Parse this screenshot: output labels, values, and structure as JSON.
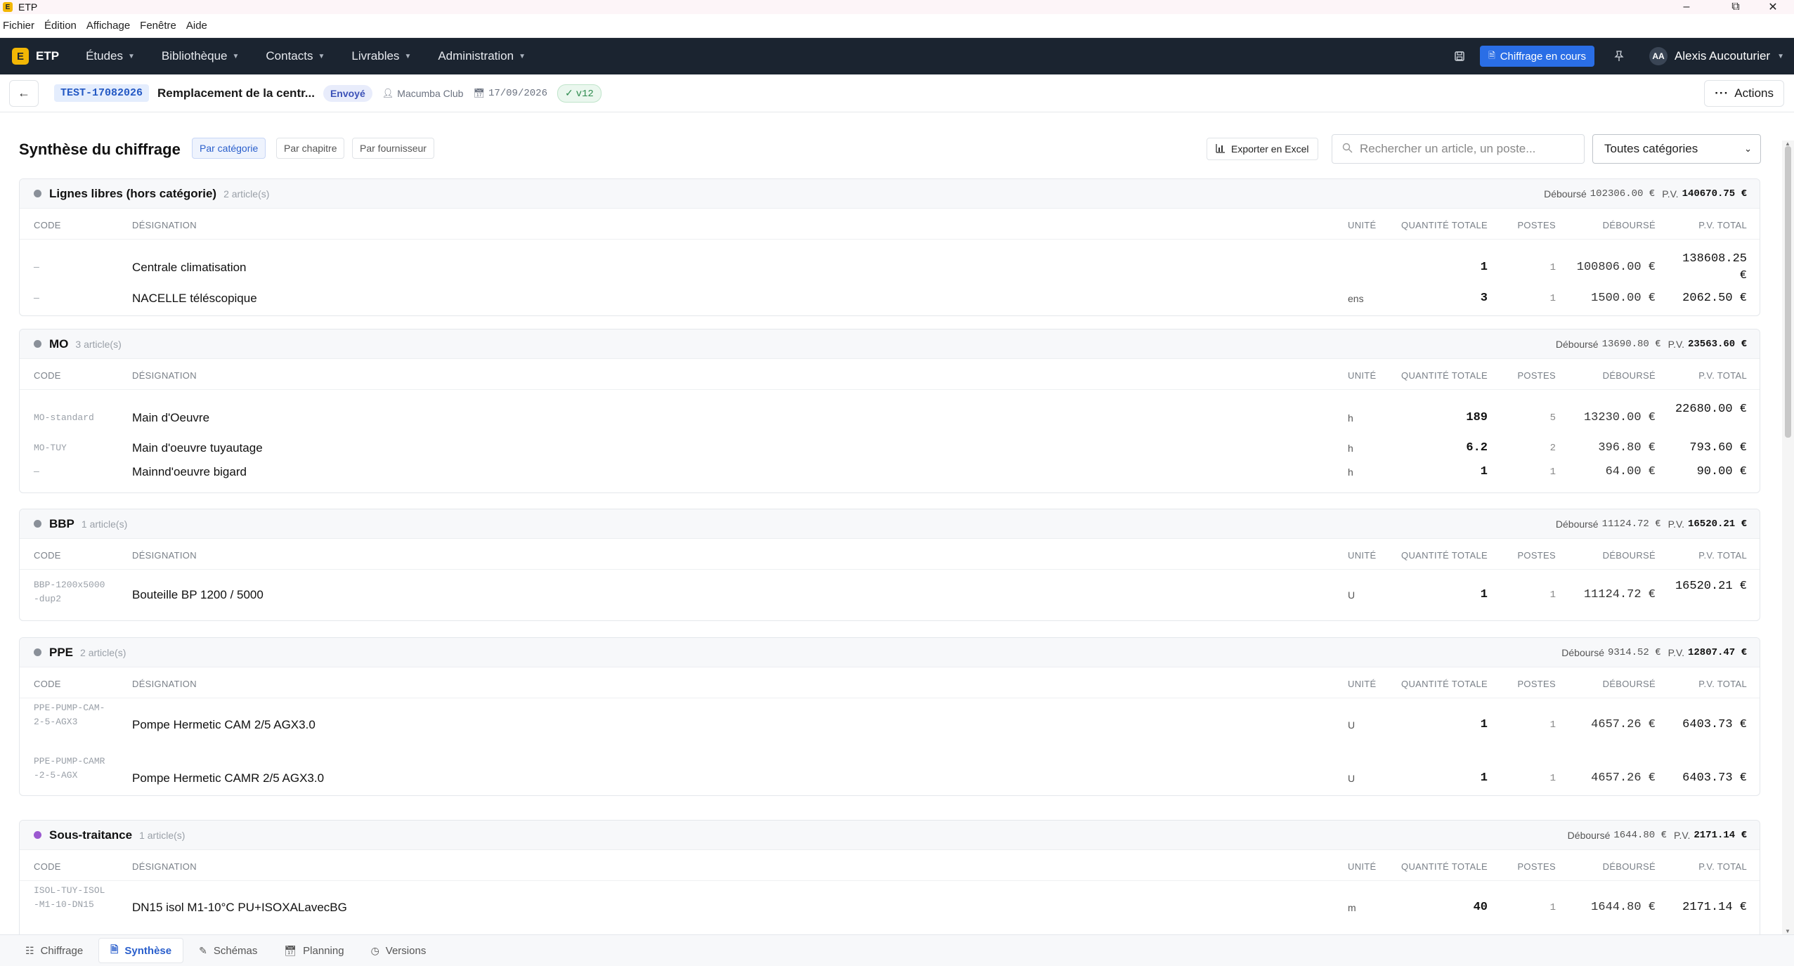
{
  "window": {
    "title": "ETP",
    "app_icon_letter": "E"
  },
  "menu": [
    "Fichier",
    "Édition",
    "Affichage",
    "Fenêtre",
    "Aide"
  ],
  "nav": {
    "brand": "ETP",
    "brand_logo_letter": "E",
    "items": [
      "Études",
      "Bibliothèque",
      "Contacts",
      "Livrables",
      "Administration"
    ],
    "chiffrage_button": "Chiffrage en cours",
    "user_initials": "AA",
    "user_name": "Alexis Aucouturier"
  },
  "header": {
    "reference": "TEST-17082026",
    "project_title": "Remplacement de la centr...",
    "status": "Envoyé",
    "client": "Macumba Club",
    "date": "17/09/2026",
    "version": "v12",
    "actions_label": "Actions"
  },
  "toolbar": {
    "title": "Synthèse du chiffrage",
    "segments": [
      "Par catégorie",
      "Par chapitre",
      "Par fournisseur"
    ],
    "export_label": "Exporter en Excel",
    "search_placeholder": "Rechercher un article, un poste...",
    "category_select": "Toutes catégories"
  },
  "columns": {
    "code": "CODE",
    "designation": "DÉSIGNATION",
    "unit": "UNITÉ",
    "qty": "QUANTITÉ TOTALE",
    "postes": "POSTES",
    "debourse": "DÉBOURSÉ",
    "pv": "P.V. TOTAL"
  },
  "labels": {
    "debourse": "Déboursé",
    "pv": "P.V."
  },
  "categories": [
    {
      "name": "Lignes libres (hors catégorie)",
      "count": "2 article(s)",
      "debourse": "102306.00 €",
      "pv": "140670.75 €",
      "dot_color": "#8a9099",
      "rows": [
        {
          "code": "—",
          "designation": "Centrale climatisation",
          "unit": "",
          "qty": "1",
          "postes": "1",
          "debourse": "100806.00 €",
          "pv": "138608.25 €"
        },
        {
          "code": "—",
          "designation": "NACELLE téléscopique",
          "unit": "ens",
          "qty": "3",
          "postes": "1",
          "debourse": "1500.00 €",
          "pv": "2062.50 €"
        }
      ]
    },
    {
      "name": "MO",
      "count": "3 article(s)",
      "debourse": "13690.80 €",
      "pv": "23563.60 €",
      "dot_color": "#8a9099",
      "rows": [
        {
          "code": "MO-standard",
          "designation": "Main d'Oeuvre",
          "unit": "h",
          "qty": "189",
          "postes": "5",
          "debourse": "13230.00 €",
          "pv": "22680.00 €"
        },
        {
          "code": "MO-TUY",
          "designation": "Main d'oeuvre tuyautage",
          "unit": "h",
          "qty": "6.2",
          "postes": "2",
          "debourse": "396.80 €",
          "pv": "793.60 €"
        },
        {
          "code": "—",
          "designation": "Mainnd'oeuvre bigard",
          "unit": "h",
          "qty": "1",
          "postes": "1",
          "debourse": "64.00 €",
          "pv": "90.00 €"
        }
      ]
    },
    {
      "name": "BBP",
      "count": "1 article(s)",
      "debourse": "11124.72 €",
      "pv": "16520.21 €",
      "dot_color": "#8a9099",
      "rows": [
        {
          "code": "BBP-1200x5000-dup2",
          "designation": "Bouteille BP 1200 / 5000",
          "unit": "U",
          "qty": "1",
          "postes": "1",
          "debourse": "11124.72 €",
          "pv": "16520.21 €"
        }
      ]
    },
    {
      "name": "PPE",
      "count": "2 article(s)",
      "debourse": "9314.52 €",
      "pv": "12807.47 €",
      "dot_color": "#8a9099",
      "rows": [
        {
          "code": "PPE-PUMP-CAM-2-5-AGX3",
          "designation": "Pompe Hermetic CAM 2/5 AGX3.0",
          "unit": "U",
          "qty": "1",
          "postes": "1",
          "debourse": "4657.26 €",
          "pv": "6403.73 €"
        },
        {
          "code": "PPE-PUMP-CAMR-2-5-AGX",
          "designation": "Pompe Hermetic CAMR 2/5 AGX3.0",
          "unit": "U",
          "qty": "1",
          "postes": "1",
          "debourse": "4657.26 €",
          "pv": "6403.73 €"
        }
      ]
    },
    {
      "name": "Sous-traitance",
      "count": "1 article(s)",
      "debourse": "1644.80 €",
      "pv": "2171.14 €",
      "dot_color": "#9b59d0",
      "rows": [
        {
          "code": "ISOL-TUY-ISOL-M1-10-DN15",
          "designation": "DN15 isol M1-10°C PU+ISOXALavecBG",
          "unit": "m",
          "qty": "40",
          "postes": "1",
          "debourse": "1644.80 €",
          "pv": "2171.14 €"
        }
      ]
    }
  ],
  "bottom_tabs": [
    "Chiffrage",
    "Synthèse",
    "Schémas",
    "Planning",
    "Versions"
  ]
}
